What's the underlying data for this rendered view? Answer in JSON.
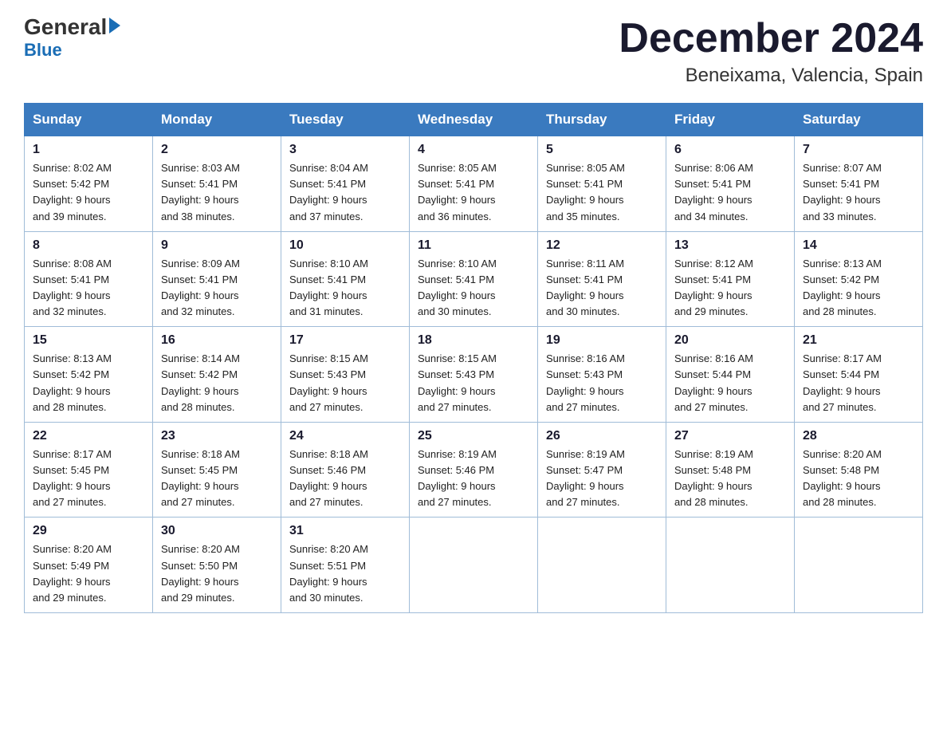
{
  "header": {
    "logo_general": "General",
    "logo_blue": "Blue",
    "cal_title": "December 2024",
    "cal_subtitle": "Beneixama, Valencia, Spain"
  },
  "weekdays": [
    "Sunday",
    "Monday",
    "Tuesday",
    "Wednesday",
    "Thursday",
    "Friday",
    "Saturday"
  ],
  "weeks": [
    [
      {
        "day": "1",
        "sunrise": "8:02 AM",
        "sunset": "5:42 PM",
        "daylight": "9 hours and 39 minutes."
      },
      {
        "day": "2",
        "sunrise": "8:03 AM",
        "sunset": "5:41 PM",
        "daylight": "9 hours and 38 minutes."
      },
      {
        "day": "3",
        "sunrise": "8:04 AM",
        "sunset": "5:41 PM",
        "daylight": "9 hours and 37 minutes."
      },
      {
        "day": "4",
        "sunrise": "8:05 AM",
        "sunset": "5:41 PM",
        "daylight": "9 hours and 36 minutes."
      },
      {
        "day": "5",
        "sunrise": "8:05 AM",
        "sunset": "5:41 PM",
        "daylight": "9 hours and 35 minutes."
      },
      {
        "day": "6",
        "sunrise": "8:06 AM",
        "sunset": "5:41 PM",
        "daylight": "9 hours and 34 minutes."
      },
      {
        "day": "7",
        "sunrise": "8:07 AM",
        "sunset": "5:41 PM",
        "daylight": "9 hours and 33 minutes."
      }
    ],
    [
      {
        "day": "8",
        "sunrise": "8:08 AM",
        "sunset": "5:41 PM",
        "daylight": "9 hours and 32 minutes."
      },
      {
        "day": "9",
        "sunrise": "8:09 AM",
        "sunset": "5:41 PM",
        "daylight": "9 hours and 32 minutes."
      },
      {
        "day": "10",
        "sunrise": "8:10 AM",
        "sunset": "5:41 PM",
        "daylight": "9 hours and 31 minutes."
      },
      {
        "day": "11",
        "sunrise": "8:10 AM",
        "sunset": "5:41 PM",
        "daylight": "9 hours and 30 minutes."
      },
      {
        "day": "12",
        "sunrise": "8:11 AM",
        "sunset": "5:41 PM",
        "daylight": "9 hours and 30 minutes."
      },
      {
        "day": "13",
        "sunrise": "8:12 AM",
        "sunset": "5:41 PM",
        "daylight": "9 hours and 29 minutes."
      },
      {
        "day": "14",
        "sunrise": "8:13 AM",
        "sunset": "5:42 PM",
        "daylight": "9 hours and 28 minutes."
      }
    ],
    [
      {
        "day": "15",
        "sunrise": "8:13 AM",
        "sunset": "5:42 PM",
        "daylight": "9 hours and 28 minutes."
      },
      {
        "day": "16",
        "sunrise": "8:14 AM",
        "sunset": "5:42 PM",
        "daylight": "9 hours and 28 minutes."
      },
      {
        "day": "17",
        "sunrise": "8:15 AM",
        "sunset": "5:43 PM",
        "daylight": "9 hours and 27 minutes."
      },
      {
        "day": "18",
        "sunrise": "8:15 AM",
        "sunset": "5:43 PM",
        "daylight": "9 hours and 27 minutes."
      },
      {
        "day": "19",
        "sunrise": "8:16 AM",
        "sunset": "5:43 PM",
        "daylight": "9 hours and 27 minutes."
      },
      {
        "day": "20",
        "sunrise": "8:16 AM",
        "sunset": "5:44 PM",
        "daylight": "9 hours and 27 minutes."
      },
      {
        "day": "21",
        "sunrise": "8:17 AM",
        "sunset": "5:44 PM",
        "daylight": "9 hours and 27 minutes."
      }
    ],
    [
      {
        "day": "22",
        "sunrise": "8:17 AM",
        "sunset": "5:45 PM",
        "daylight": "9 hours and 27 minutes."
      },
      {
        "day": "23",
        "sunrise": "8:18 AM",
        "sunset": "5:45 PM",
        "daylight": "9 hours and 27 minutes."
      },
      {
        "day": "24",
        "sunrise": "8:18 AM",
        "sunset": "5:46 PM",
        "daylight": "9 hours and 27 minutes."
      },
      {
        "day": "25",
        "sunrise": "8:19 AM",
        "sunset": "5:46 PM",
        "daylight": "9 hours and 27 minutes."
      },
      {
        "day": "26",
        "sunrise": "8:19 AM",
        "sunset": "5:47 PM",
        "daylight": "9 hours and 27 minutes."
      },
      {
        "day": "27",
        "sunrise": "8:19 AM",
        "sunset": "5:48 PM",
        "daylight": "9 hours and 28 minutes."
      },
      {
        "day": "28",
        "sunrise": "8:20 AM",
        "sunset": "5:48 PM",
        "daylight": "9 hours and 28 minutes."
      }
    ],
    [
      {
        "day": "29",
        "sunrise": "8:20 AM",
        "sunset": "5:49 PM",
        "daylight": "9 hours and 29 minutes."
      },
      {
        "day": "30",
        "sunrise": "8:20 AM",
        "sunset": "5:50 PM",
        "daylight": "9 hours and 29 minutes."
      },
      {
        "day": "31",
        "sunrise": "8:20 AM",
        "sunset": "5:51 PM",
        "daylight": "9 hours and 30 minutes."
      },
      null,
      null,
      null,
      null
    ]
  ],
  "labels": {
    "sunrise": "Sunrise:",
    "sunset": "Sunset:",
    "daylight": "Daylight:"
  }
}
